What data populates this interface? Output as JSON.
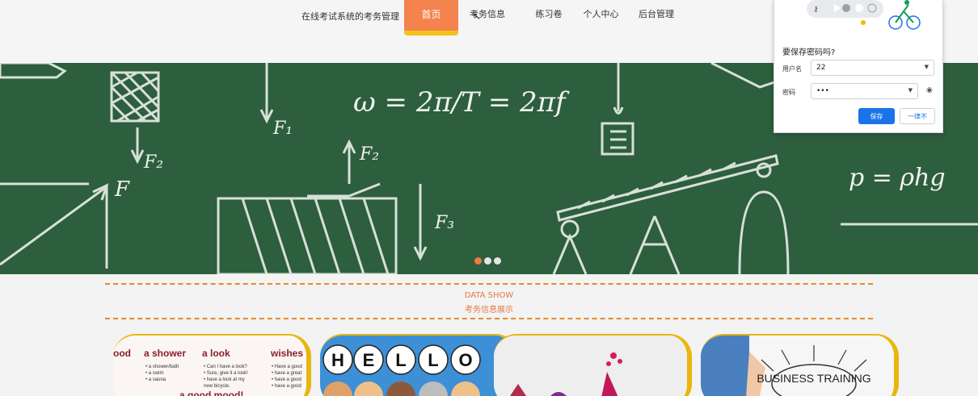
{
  "header": {
    "site_title": "在线考试系统的考务管理",
    "nav": [
      "首页",
      "考务信息",
      "练习卷",
      "个人中心",
      "后台管理"
    ],
    "active_index": 0
  },
  "banner": {
    "formula_omega": "ω = 2π/T = 2πf",
    "formula_p": "p = ρhg",
    "label_f1": "F₁",
    "label_f2": "F₂",
    "label_f3": "F₃",
    "label_f": "F",
    "slide_count": 3,
    "active_slide": 0
  },
  "section": {
    "title_en": "DATA SHOW",
    "title_cn": "考务信息展示"
  },
  "cards": [
    {
      "name": "english-phrases",
      "phrases": [
        "a shower",
        "a look",
        "wishes",
        "a good mood!"
      ]
    },
    {
      "name": "hello",
      "text": "HELLO"
    },
    {
      "name": "abstract-art"
    },
    {
      "name": "business-training",
      "text": "BUSINESS TRAINING"
    }
  ],
  "password_popup": {
    "title": "要保存密码吗?",
    "username_label": "用户名",
    "username_value": "22",
    "password_label": "密码",
    "password_value": "•••",
    "save_label": "保存",
    "never_label": "一律不"
  },
  "colors": {
    "nav_active": "#f5834d",
    "nav_underline": "#f3c21b",
    "banner": "#2c5e3f",
    "section_accent": "#e37b43",
    "save_button": "#1a73e8"
  }
}
